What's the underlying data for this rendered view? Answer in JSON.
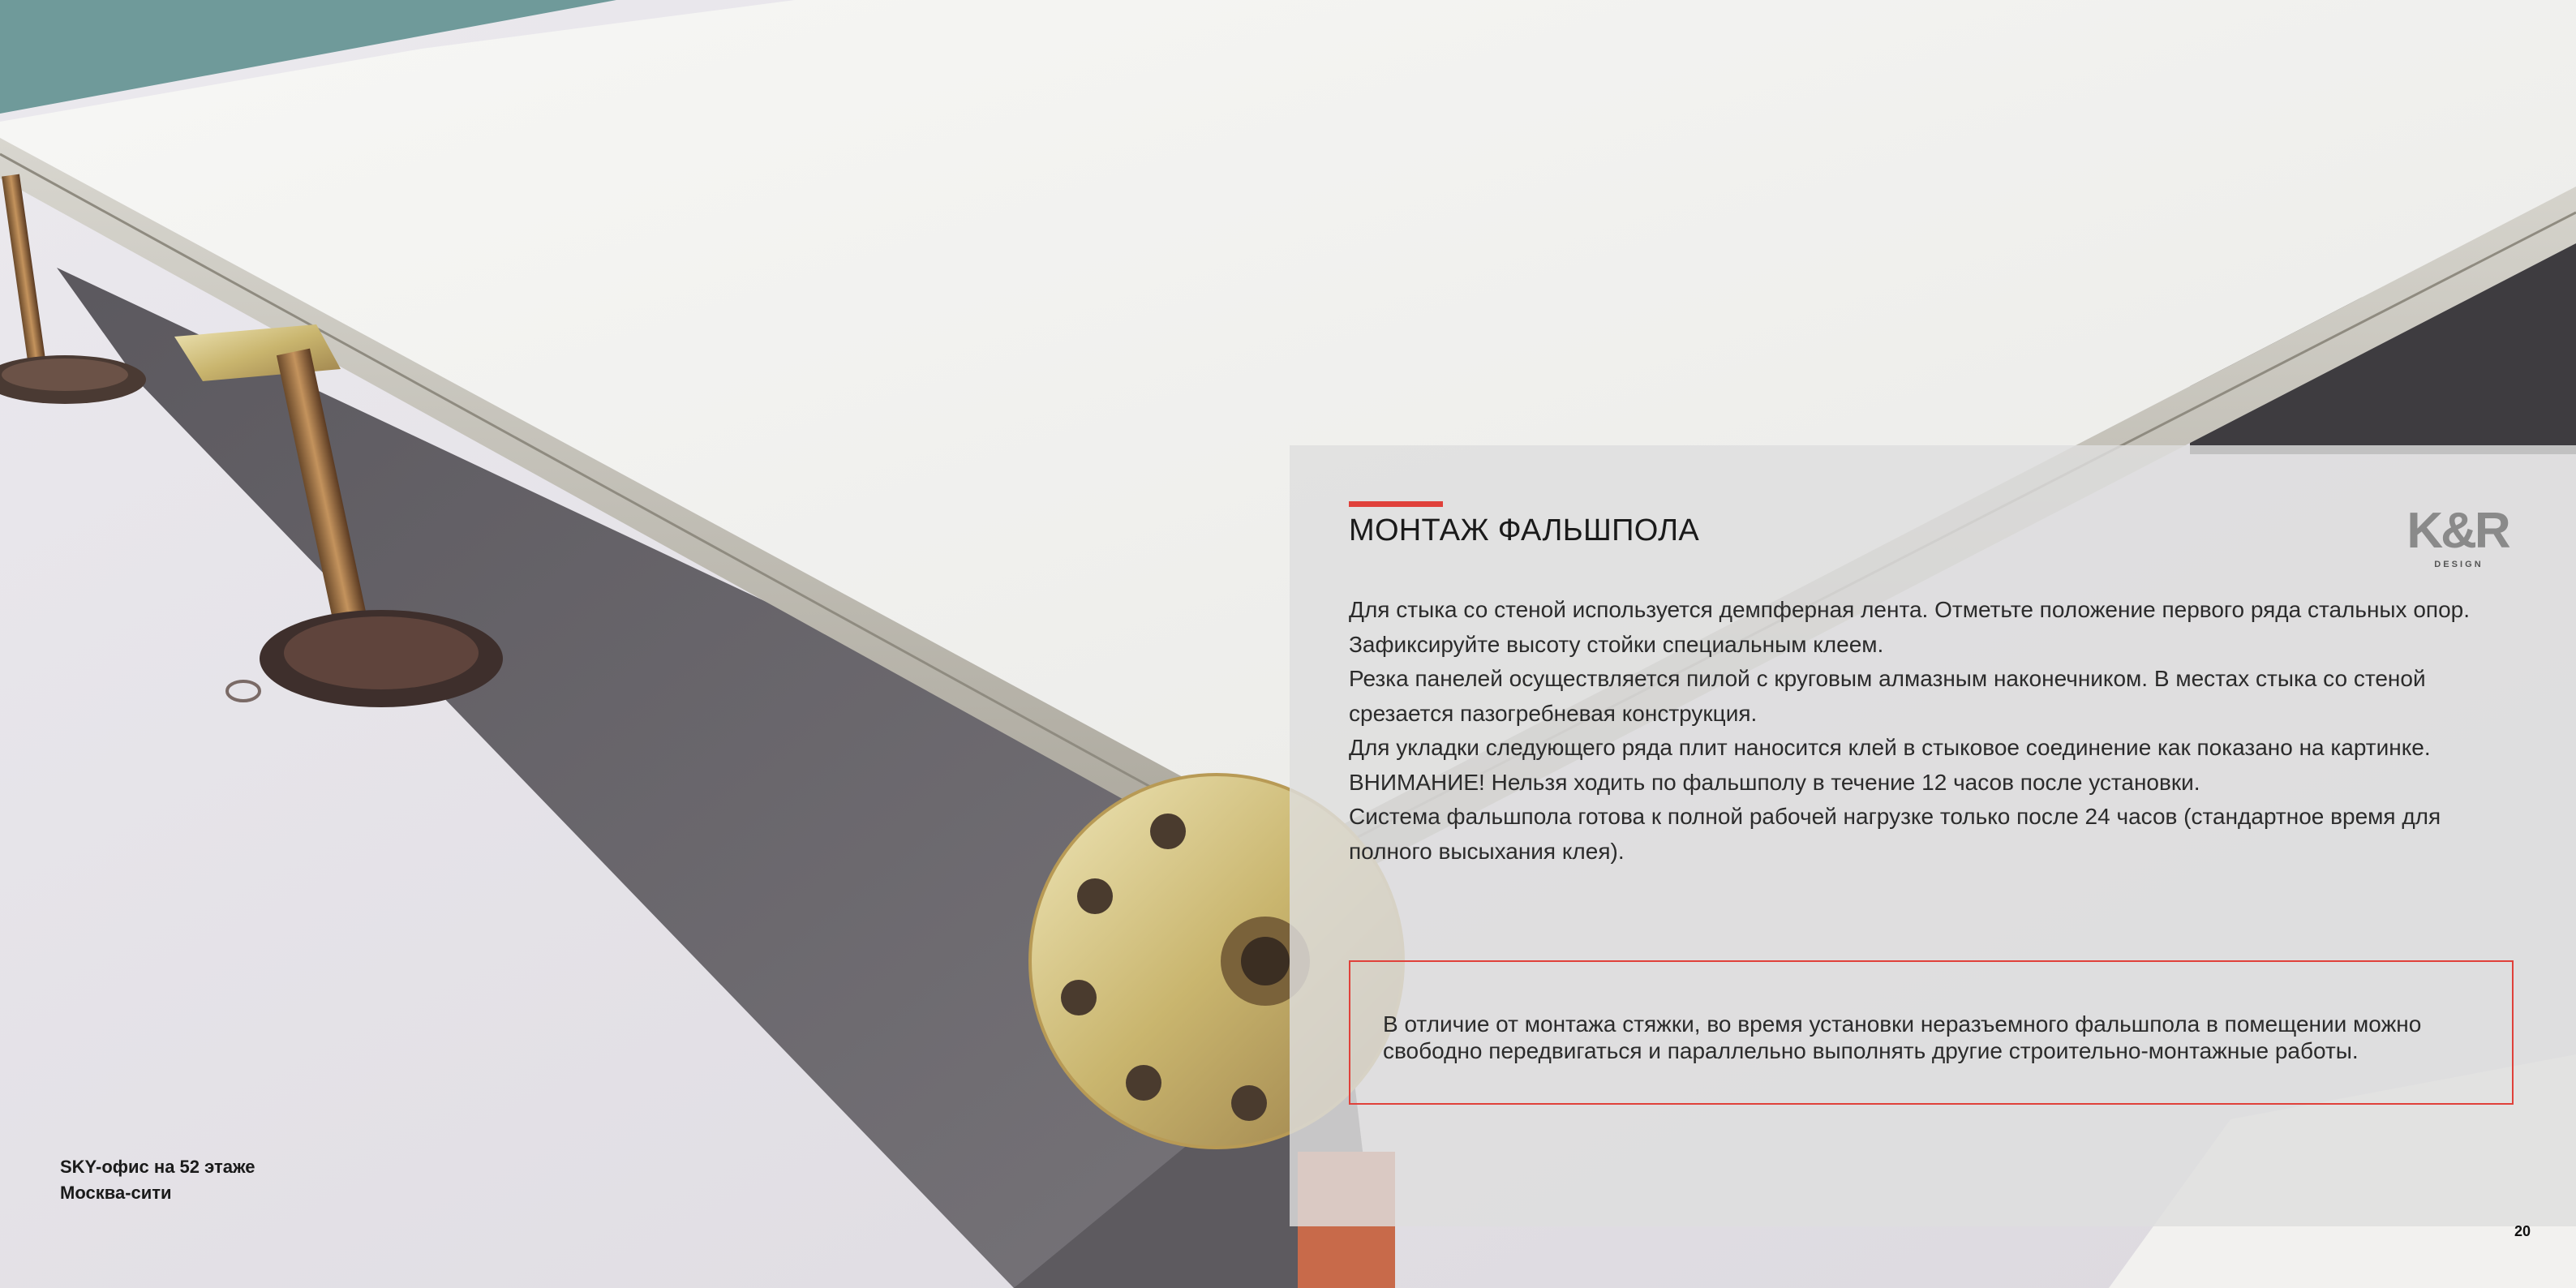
{
  "panel": {
    "title": "МОНТАЖ ФАЛЬШПОЛА",
    "paragraphs": [
      "Для стыка со стеной используется демпферная лента. Отметьте положение первого ряда стальных опор.",
      "Зафиксируйте высоту стойки специальным клеем.",
      "Резка панелей осуществляется пилой с круговым алмазным наконечником. В местах стыка со стеной срезается пазогребневая конструкция.",
      "Для укладки следующего ряда плит наносится клей в стыковое соединение как показано на картинке.",
      "ВНИМАНИЕ! Нельзя ходить по фальшполу в течение 12 часов после установки.",
      "Система фальшпола готова к полной рабочей нагрузке только после 24 часов (стандартное время для полного высыхания клея)."
    ],
    "notice": "В отличие от монтажа стяжки, во время установки неразъемного фальшпола в помещении можно свободно передвигаться и параллельно выполнять другие строительно-монтажные работы."
  },
  "logo": {
    "main": "K&R",
    "sub": "D E S I G N"
  },
  "caption": {
    "line1": "SKY-офис на 52 этаже",
    "line2": "Москва-сити"
  },
  "page_number": "20",
  "colors": {
    "accent": "#e0413a",
    "panel_bg": "#dedede",
    "text": "#2b2b2b",
    "logo": "#8a8a8a"
  }
}
